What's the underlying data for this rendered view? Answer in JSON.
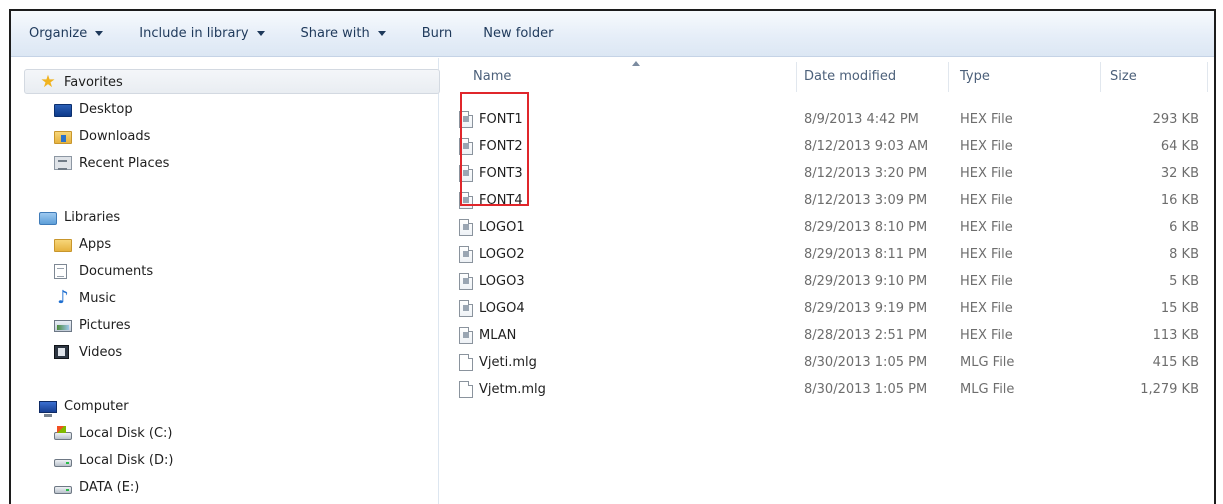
{
  "toolbar": {
    "organize": "Organize",
    "include_in_library": "Include in library",
    "share_with": "Share with",
    "burn": "Burn",
    "new_folder": "New folder"
  },
  "nav": {
    "favorites": {
      "label": "Favorites",
      "items": [
        {
          "label": "Desktop",
          "icon": "desktop-icon"
        },
        {
          "label": "Downloads",
          "icon": "downloads-folder-icon"
        },
        {
          "label": "Recent Places",
          "icon": "recent-places-icon"
        }
      ]
    },
    "libraries": {
      "label": "Libraries",
      "items": [
        {
          "label": "Apps",
          "icon": "folder-icon"
        },
        {
          "label": "Documents",
          "icon": "documents-icon"
        },
        {
          "label": "Music",
          "icon": "music-icon"
        },
        {
          "label": "Pictures",
          "icon": "pictures-icon"
        },
        {
          "label": "Videos",
          "icon": "videos-icon"
        }
      ]
    },
    "computer": {
      "label": "Computer",
      "items": [
        {
          "label": "Local Disk (C:)",
          "icon": "system-drive-icon"
        },
        {
          "label": "Local Disk (D:)",
          "icon": "drive-icon"
        },
        {
          "label": "DATA (E:)",
          "icon": "drive-icon"
        }
      ]
    }
  },
  "columns": {
    "name": "Name",
    "date_modified": "Date modified",
    "type": "Type",
    "size": "Size"
  },
  "files": [
    {
      "name": "FONT1",
      "date": "8/9/2013 4:42 PM",
      "type": "HEX File",
      "size": "293 KB"
    },
    {
      "name": "FONT2",
      "date": "8/12/2013 9:03 AM",
      "type": "HEX File",
      "size": "64 KB"
    },
    {
      "name": "FONT3",
      "date": "8/12/2013 3:20 PM",
      "type": "HEX File",
      "size": "32 KB"
    },
    {
      "name": "FONT4",
      "date": "8/12/2013 3:09 PM",
      "type": "HEX File",
      "size": "16 KB"
    },
    {
      "name": "LOGO1",
      "date": "8/29/2013 8:10 PM",
      "type": "HEX File",
      "size": "6 KB"
    },
    {
      "name": "LOGO2",
      "date": "8/29/2013 8:11 PM",
      "type": "HEX File",
      "size": "8 KB"
    },
    {
      "name": "LOGO3",
      "date": "8/29/2013 9:10 PM",
      "type": "HEX File",
      "size": "5 KB"
    },
    {
      "name": "LOGO4",
      "date": "8/29/2013 9:19 PM",
      "type": "HEX File",
      "size": "15 KB"
    },
    {
      "name": "MLAN",
      "date": "8/28/2013 2:51 PM",
      "type": "HEX File",
      "size": "113 KB"
    },
    {
      "name": "Vjeti.mlg",
      "date": "8/30/2013 1:05 PM",
      "type": "MLG File",
      "size": "415 KB"
    },
    {
      "name": "Vjetm.mlg",
      "date": "8/30/2013 1:05 PM",
      "type": "MLG File",
      "size": "1,279 KB"
    }
  ],
  "colors": {
    "highlight": "#e0262b",
    "toolbar_text": "#1e395b",
    "header_text": "#4c607a"
  }
}
